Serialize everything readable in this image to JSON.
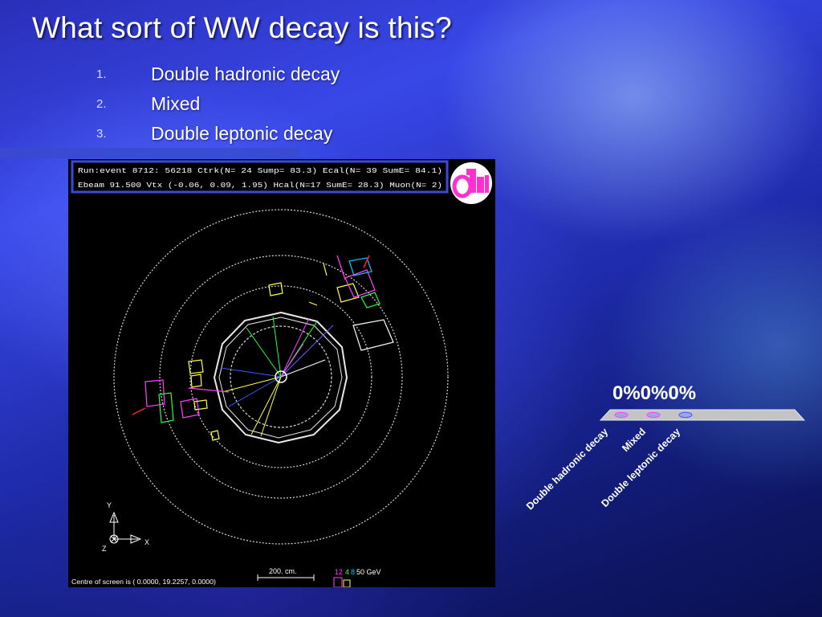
{
  "slide": {
    "title": "What sort of WW decay is this?"
  },
  "options": [
    {
      "number": "1.",
      "label": "Double hadronic decay"
    },
    {
      "number": "2.",
      "label": "Mixed"
    },
    {
      "number": "3.",
      "label": "Double leptonic decay"
    }
  ],
  "event_display": {
    "header_line_1": "Run:event 8712: 56218    Ctrk(N= 24 Sump= 83.3) Ecal(N= 39 SumE= 84.1)",
    "header_line_2": "Ebeam 91.500 Vtx (-0.06, 0.09, 1.95)  Hcal(N=17 SumE= 28.3) Muon(N= 2)",
    "axis_y": "Y",
    "axis_x": "X",
    "axis_z": "Z",
    "scale_label": "200. cm.",
    "energy_scale": {
      "n1": "12",
      "n2": "4",
      "n3": "8",
      "unit": "50 GeV"
    },
    "centre_text": "Centre of screen is (    0.0000,   19.2257,    0.0000)",
    "colors": {
      "frame": "#3a4ad8",
      "cyan": "#00c8ff",
      "magenta": "#ff40ff",
      "green": "#20ff40",
      "yellow": "#ffff40"
    }
  },
  "results": {
    "value_text": "0%0%0%",
    "labels": [
      "Double hadronic decay",
      "Mixed",
      "Double leptonic decay"
    ]
  }
}
